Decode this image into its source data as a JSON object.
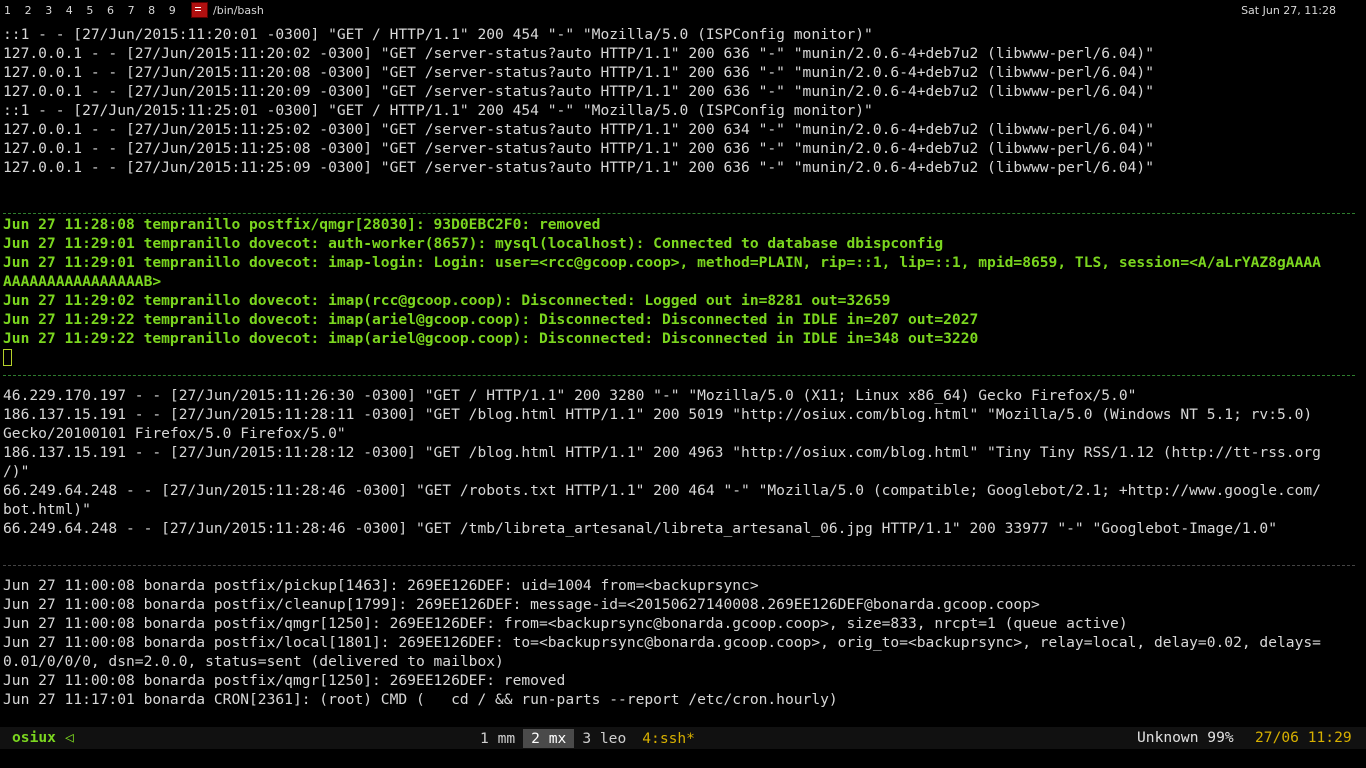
{
  "topbar": {
    "workspaces": [
      "1",
      "2",
      "3",
      "4",
      "5",
      "6",
      "7",
      "8",
      "9"
    ],
    "window_title": "/bin/bash",
    "clock": "Sat Jun 27, 11:28"
  },
  "pane_top": {
    "lines": [
      "::1 - - [27/Jun/2015:11:20:01 -0300] \"GET / HTTP/1.1\" 200 454 \"-\" \"Mozilla/5.0 (ISPConfig monitor)\"",
      "127.0.0.1 - - [27/Jun/2015:11:20:02 -0300] \"GET /server-status?auto HTTP/1.1\" 200 636 \"-\" \"munin/2.0.6-4+deb7u2 (libwww-perl/6.04)\"",
      "127.0.0.1 - - [27/Jun/2015:11:20:08 -0300] \"GET /server-status?auto HTTP/1.1\" 200 636 \"-\" \"munin/2.0.6-4+deb7u2 (libwww-perl/6.04)\"",
      "127.0.0.1 - - [27/Jun/2015:11:20:09 -0300] \"GET /server-status?auto HTTP/1.1\" 200 636 \"-\" \"munin/2.0.6-4+deb7u2 (libwww-perl/6.04)\"",
      "::1 - - [27/Jun/2015:11:25:01 -0300] \"GET / HTTP/1.1\" 200 454 \"-\" \"Mozilla/5.0 (ISPConfig monitor)\"",
      "127.0.0.1 - - [27/Jun/2015:11:25:02 -0300] \"GET /server-status?auto HTTP/1.1\" 200 634 \"-\" \"munin/2.0.6-4+deb7u2 (libwww-perl/6.04)\"",
      "127.0.0.1 - - [27/Jun/2015:11:25:08 -0300] \"GET /server-status?auto HTTP/1.1\" 200 636 \"-\" \"munin/2.0.6-4+deb7u2 (libwww-perl/6.04)\"",
      "127.0.0.1 - - [27/Jun/2015:11:25:09 -0300] \"GET /server-status?auto HTTP/1.1\" 200 636 \"-\" \"munin/2.0.6-4+deb7u2 (libwww-perl/6.04)\""
    ]
  },
  "pane_green": {
    "lines": [
      "Jun 27 11:28:08 tempranillo postfix/qmgr[28030]: 93D0EBC2F0: removed",
      "Jun 27 11:29:01 tempranillo dovecot: auth-worker(8657): mysql(localhost): Connected to database dbispconfig",
      "Jun 27 11:29:01 tempranillo dovecot: imap-login: Login: user=<rcc@gcoop.coop>, method=PLAIN, rip=::1, lip=::1, mpid=8659, TLS, session=<A/aLrYAZ8gAAAA",
      "AAAAAAAAAAAAAAAAB>",
      "Jun 27 11:29:02 tempranillo dovecot: imap(rcc@gcoop.coop): Disconnected: Logged out in=8281 out=32659",
      "Jun 27 11:29:22 tempranillo dovecot: imap(ariel@gcoop.coop): Disconnected: Disconnected in IDLE in=207 out=2027",
      "Jun 27 11:29:22 tempranillo dovecot: imap(ariel@gcoop.coop): Disconnected: Disconnected in IDLE in=348 out=3220"
    ]
  },
  "pane_web": {
    "lines": [
      "46.229.170.197 - - [27/Jun/2015:11:26:30 -0300] \"GET / HTTP/1.1\" 200 3280 \"-\" \"Mozilla/5.0 (X11; Linux x86_64) Gecko Firefox/5.0\"",
      "186.137.15.191 - - [27/Jun/2015:11:28:11 -0300] \"GET /blog.html HTTP/1.1\" 200 5019 \"http://osiux.com/blog.html\" \"Mozilla/5.0 (Windows NT 5.1; rv:5.0)",
      "Gecko/20100101 Firefox/5.0 Firefox/5.0\"",
      "186.137.15.191 - - [27/Jun/2015:11:28:12 -0300] \"GET /blog.html HTTP/1.1\" 200 4963 \"http://osiux.com/blog.html\" \"Tiny Tiny RSS/1.12 (http://tt-rss.org",
      "/)\"",
      "66.249.64.248 - - [27/Jun/2015:11:28:46 -0300] \"GET /robots.txt HTTP/1.1\" 200 464 \"-\" \"Mozilla/5.0 (compatible; Googlebot/2.1; +http://www.google.com/",
      "bot.html)\"",
      "66.249.64.248 - - [27/Jun/2015:11:28:46 -0300] \"GET /tmb/libreta_artesanal/libreta_artesanal_06.jpg HTTP/1.1\" 200 33977 \"-\" \"Googlebot-Image/1.0\""
    ]
  },
  "pane_mail": {
    "lines": [
      "Jun 27 11:00:08 bonarda postfix/pickup[1463]: 269EE126DEF: uid=1004 from=<backuprsync>",
      "Jun 27 11:00:08 bonarda postfix/cleanup[1799]: 269EE126DEF: message-id=<20150627140008.269EE126DEF@bonarda.gcoop.coop>",
      "Jun 27 11:00:08 bonarda postfix/qmgr[1250]: 269EE126DEF: from=<backuprsync@bonarda.gcoop.coop>, size=833, nrcpt=1 (queue active)",
      "Jun 27 11:00:08 bonarda postfix/local[1801]: 269EE126DEF: to=<backuprsync@bonarda.gcoop.coop>, orig_to=<backuprsync>, relay=local, delay=0.02, delays=",
      "0.01/0/0/0, dsn=2.0.0, status=sent (delivered to mailbox)",
      "Jun 27 11:00:08 bonarda postfix/qmgr[1250]: 269EE126DEF: removed",
      "Jun 27 11:17:01 bonarda CRON[2361]: (root) CMD (   cd / && run-parts --report /etc/cron.hourly)"
    ]
  },
  "statusbar": {
    "session": "osiux",
    "arrow": "◁",
    "tabs": [
      {
        "label": "1 mm"
      },
      {
        "label": "2 mx"
      },
      {
        "label": "3 leo"
      },
      {
        "label": "4:ssh*"
      }
    ],
    "sysinfo": "Unknown 99%",
    "datetime": "27/06 11:29"
  }
}
